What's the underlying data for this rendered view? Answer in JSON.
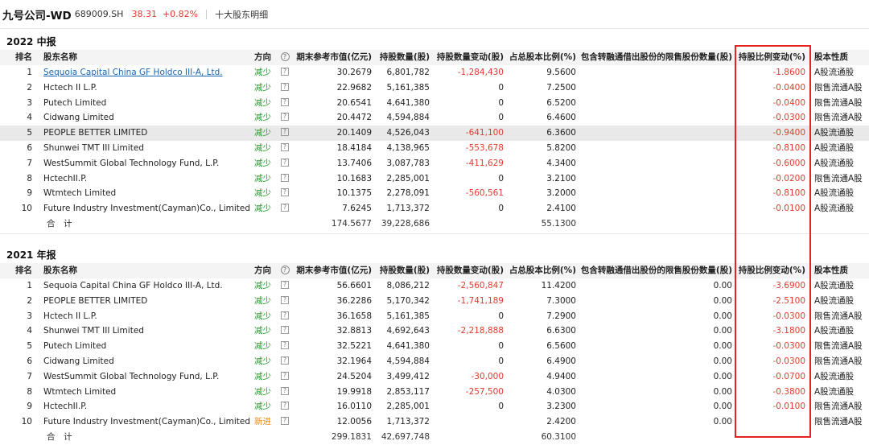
{
  "header": {
    "name": "九号公司-WD",
    "code": "689009.SH",
    "price": "38.31",
    "change_pct": "+0.82%",
    "title": "十大股东明细"
  },
  "columns": {
    "rank": "排名",
    "name": "股东名称",
    "direction": "方向",
    "help": "?",
    "value": "期末参考市值(亿元)",
    "count": "持股数量(股)",
    "count_change": "持股数量变动(股)",
    "ratio": "占总股本比例(%)",
    "restricted": "包含转融通借出股份的限售股份数量(股)",
    "ratio_change": "持股比例变动(%)",
    "nature": "股本性质"
  },
  "help_glyph": "?",
  "colors": {
    "up": "#e23b2e",
    "down": "#27a12f",
    "new": "#f08a15",
    "link": "#1766b3",
    "highlight_frame": "#e5231d"
  },
  "sections": [
    {
      "title": "2022 中报",
      "rows": [
        {
          "rank": "1",
          "name": "Sequoia Capital China GF Holdco III-A, Ltd.",
          "link": true,
          "direction": "减少",
          "value": "30.2679",
          "count": "6,801,782",
          "count_change": "-1,284,430",
          "ratio": "9.5600",
          "restricted": "",
          "ratio_change": "-1.8600",
          "nature": "A股流通股"
        },
        {
          "rank": "2",
          "name": "Hctech II L.P.",
          "link": false,
          "direction": "减少",
          "value": "22.9682",
          "count": "5,161,385",
          "count_change": "0",
          "ratio": "7.2500",
          "restricted": "",
          "ratio_change": "-0.0400",
          "nature": "限售流通A股"
        },
        {
          "rank": "3",
          "name": "Putech Limited",
          "link": false,
          "direction": "减少",
          "value": "20.6541",
          "count": "4,641,380",
          "count_change": "0",
          "ratio": "6.5200",
          "restricted": "",
          "ratio_change": "-0.0400",
          "nature": "限售流通A股"
        },
        {
          "rank": "4",
          "name": "Cidwang Limited",
          "link": false,
          "direction": "减少",
          "value": "20.4472",
          "count": "4,594,884",
          "count_change": "0",
          "ratio": "6.4600",
          "restricted": "",
          "ratio_change": "-0.0300",
          "nature": "限售流通A股"
        },
        {
          "rank": "5",
          "name": "PEOPLE BETTER LIMITED",
          "link": false,
          "direction": "减少",
          "value": "20.1409",
          "count": "4,526,043",
          "count_change": "-641,100",
          "ratio": "6.3600",
          "restricted": "",
          "ratio_change": "-0.9400",
          "nature": "A股流通股",
          "selected": true
        },
        {
          "rank": "6",
          "name": "Shunwei TMT III Limited",
          "link": false,
          "direction": "减少",
          "value": "18.4184",
          "count": "4,138,965",
          "count_change": "-553,678",
          "ratio": "5.8200",
          "restricted": "",
          "ratio_change": "-0.8100",
          "nature": "A股流通股"
        },
        {
          "rank": "7",
          "name": "WestSummit Global Technology Fund, L.P.",
          "link": false,
          "direction": "减少",
          "value": "13.7406",
          "count": "3,087,783",
          "count_change": "-411,629",
          "ratio": "4.3400",
          "restricted": "",
          "ratio_change": "-0.6000",
          "nature": "A股流通股"
        },
        {
          "rank": "8",
          "name": "HctechII.P.",
          "link": false,
          "direction": "减少",
          "value": "10.1683",
          "count": "2,285,001",
          "count_change": "0",
          "ratio": "3.2100",
          "restricted": "",
          "ratio_change": "-0.0200",
          "nature": "限售流通A股"
        },
        {
          "rank": "9",
          "name": "Wtmtech Limited",
          "link": false,
          "direction": "减少",
          "value": "10.1375",
          "count": "2,278,091",
          "count_change": "-560,561",
          "ratio": "3.2000",
          "restricted": "",
          "ratio_change": "-0.8100",
          "nature": "A股流通股"
        },
        {
          "rank": "10",
          "name": "Future Industry Investment(Cayman)Co., Limited",
          "link": false,
          "direction": "减少",
          "value": "7.6245",
          "count": "1,713,372",
          "count_change": "0",
          "ratio": "2.4100",
          "restricted": "",
          "ratio_change": "-0.0100",
          "nature": "A股流通股"
        }
      ],
      "total": {
        "label": "合　计",
        "value": "174.5677",
        "count": "39,228,686",
        "ratio": "55.1300"
      }
    },
    {
      "title": "2021 年报",
      "rows": [
        {
          "rank": "1",
          "name": "Sequoia Capital China GF Holdco III-A, Ltd.",
          "link": false,
          "direction": "减少",
          "value": "56.6601",
          "count": "8,086,212",
          "count_change": "-2,560,847",
          "ratio": "11.4200",
          "restricted": "0.00",
          "ratio_change": "-3.6900",
          "nature": "A股流通股"
        },
        {
          "rank": "2",
          "name": "PEOPLE BETTER LIMITED",
          "link": false,
          "direction": "减少",
          "value": "36.2286",
          "count": "5,170,342",
          "count_change": "-1,741,189",
          "ratio": "7.3000",
          "restricted": "0.00",
          "ratio_change": "-2.5100",
          "nature": "A股流通股"
        },
        {
          "rank": "3",
          "name": "Hctech II L.P.",
          "link": false,
          "direction": "减少",
          "value": "36.1658",
          "count": "5,161,385",
          "count_change": "0",
          "ratio": "7.2900",
          "restricted": "0.00",
          "ratio_change": "-0.0300",
          "nature": "限售流通A股"
        },
        {
          "rank": "4",
          "name": "Shunwei TMT III Limited",
          "link": false,
          "direction": "减少",
          "value": "32.8813",
          "count": "4,692,643",
          "count_change": "-2,218,888",
          "ratio": "6.6300",
          "restricted": "0.00",
          "ratio_change": "-3.1800",
          "nature": "A股流通股"
        },
        {
          "rank": "5",
          "name": "Putech Limited",
          "link": false,
          "direction": "减少",
          "value": "32.5221",
          "count": "4,641,380",
          "count_change": "0",
          "ratio": "6.5600",
          "restricted": "0.00",
          "ratio_change": "-0.0300",
          "nature": "限售流通A股"
        },
        {
          "rank": "6",
          "name": "Cidwang Limited",
          "link": false,
          "direction": "减少",
          "value": "32.1964",
          "count": "4,594,884",
          "count_change": "0",
          "ratio": "6.4900",
          "restricted": "0.00",
          "ratio_change": "-0.0300",
          "nature": "限售流通A股"
        },
        {
          "rank": "7",
          "name": "WestSummit Global Technology Fund, L.P.",
          "link": false,
          "direction": "减少",
          "value": "24.5204",
          "count": "3,499,412",
          "count_change": "-30,000",
          "ratio": "4.9400",
          "restricted": "0.00",
          "ratio_change": "-0.0700",
          "nature": "A股流通股"
        },
        {
          "rank": "8",
          "name": "Wtmtech Limited",
          "link": false,
          "direction": "减少",
          "value": "19.9918",
          "count": "2,853,117",
          "count_change": "-257,500",
          "ratio": "4.0300",
          "restricted": "0.00",
          "ratio_change": "-0.3800",
          "nature": "A股流通股"
        },
        {
          "rank": "9",
          "name": "HctechII.P.",
          "link": false,
          "direction": "减少",
          "value": "16.0110",
          "count": "2,285,001",
          "count_change": "0",
          "ratio": "3.2300",
          "restricted": "0.00",
          "ratio_change": "-0.0100",
          "nature": "限售流通A股"
        },
        {
          "rank": "10",
          "name": "Future Industry Investment(Cayman)Co., Limited",
          "link": false,
          "direction": "新进",
          "value": "12.0056",
          "count": "1,713,372",
          "count_change": "",
          "ratio": "2.4200",
          "restricted": "0.00",
          "ratio_change": "",
          "nature": "限售流通A股"
        }
      ],
      "total": {
        "label": "合　计",
        "value": "299.1831",
        "count": "42,697,748",
        "ratio": "60.3100"
      }
    }
  ]
}
